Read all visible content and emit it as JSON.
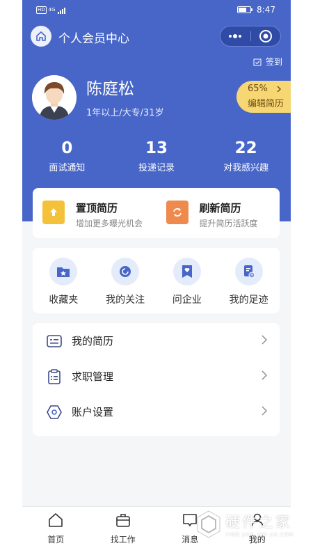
{
  "status_bar": {
    "network": "4G",
    "time": "8:47",
    "battery_level": 0.7
  },
  "nav": {
    "title": "个人会员中心"
  },
  "checkin_label": "签到",
  "profile": {
    "name": "陈庭松",
    "info": "1年以上/大专/31岁"
  },
  "resume_tag": {
    "percent": "65%",
    "label": "编辑简历"
  },
  "stats": [
    {
      "value": "0",
      "label": "面试通知"
    },
    {
      "value": "13",
      "label": "投递记录"
    },
    {
      "value": "22",
      "label": "对我感兴趣"
    }
  ],
  "promo": [
    {
      "title": "置顶简历",
      "subtitle": "增加更多曝光机会",
      "icon": "pin-top-icon",
      "color": "#f4c23a"
    },
    {
      "title": "刷新简历",
      "subtitle": "提升简历活跃度",
      "icon": "refresh-icon",
      "color": "#ef8a4f"
    }
  ],
  "quick": [
    {
      "label": "收藏夹",
      "icon": "folder-star-icon"
    },
    {
      "label": "我的关注",
      "icon": "follow-icon"
    },
    {
      "label": "问企业",
      "icon": "bookmark-heart-icon"
    },
    {
      "label": "我的足迹",
      "icon": "footprint-icon"
    }
  ],
  "menu": [
    {
      "label": "我的简历",
      "icon": "resume-icon"
    },
    {
      "label": "求职管理",
      "icon": "clipboard-icon"
    },
    {
      "label": "账户设置",
      "icon": "settings-icon"
    }
  ],
  "tabbar": [
    {
      "label": "首页",
      "icon": "home-icon"
    },
    {
      "label": "找工作",
      "icon": "briefcase-icon"
    },
    {
      "label": "消息",
      "icon": "message-icon"
    },
    {
      "label": "我的",
      "icon": "user-icon"
    }
  ],
  "watermark": {
    "title": "硬件之家",
    "subtitle": "YING JIAN ZHI JIA.COM"
  },
  "colors": {
    "brand": "#4766c8",
    "accent_gold": "#f7d774",
    "icon_blue": "#4766c8"
  }
}
